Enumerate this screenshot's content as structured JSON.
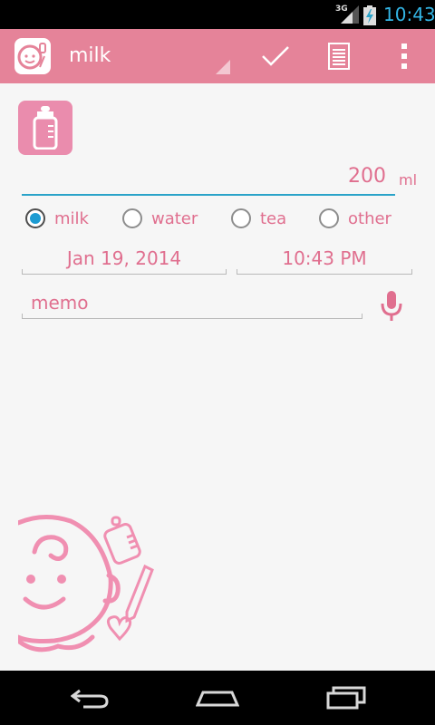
{
  "status_bar": {
    "network": "3G",
    "time": "10:43"
  },
  "action_bar": {
    "title": "milk",
    "actions": [
      "check-icon",
      "list-icon",
      "overflow-menu-icon"
    ]
  },
  "form": {
    "amount": "200",
    "unit": "ml",
    "drink_types": [
      {
        "label": "milk",
        "checked": true
      },
      {
        "label": "water",
        "checked": false
      },
      {
        "label": "tea",
        "checked": false
      },
      {
        "label": "other",
        "checked": false
      }
    ],
    "date": "Jan 19, 2014",
    "time": "10:43 PM",
    "memo_placeholder": "memo"
  },
  "colors": {
    "accent_pink": "#e58399",
    "text_pink": "#e06f8f",
    "focus_blue": "#2aa3c9",
    "radio_blue": "#1c9bd2"
  }
}
